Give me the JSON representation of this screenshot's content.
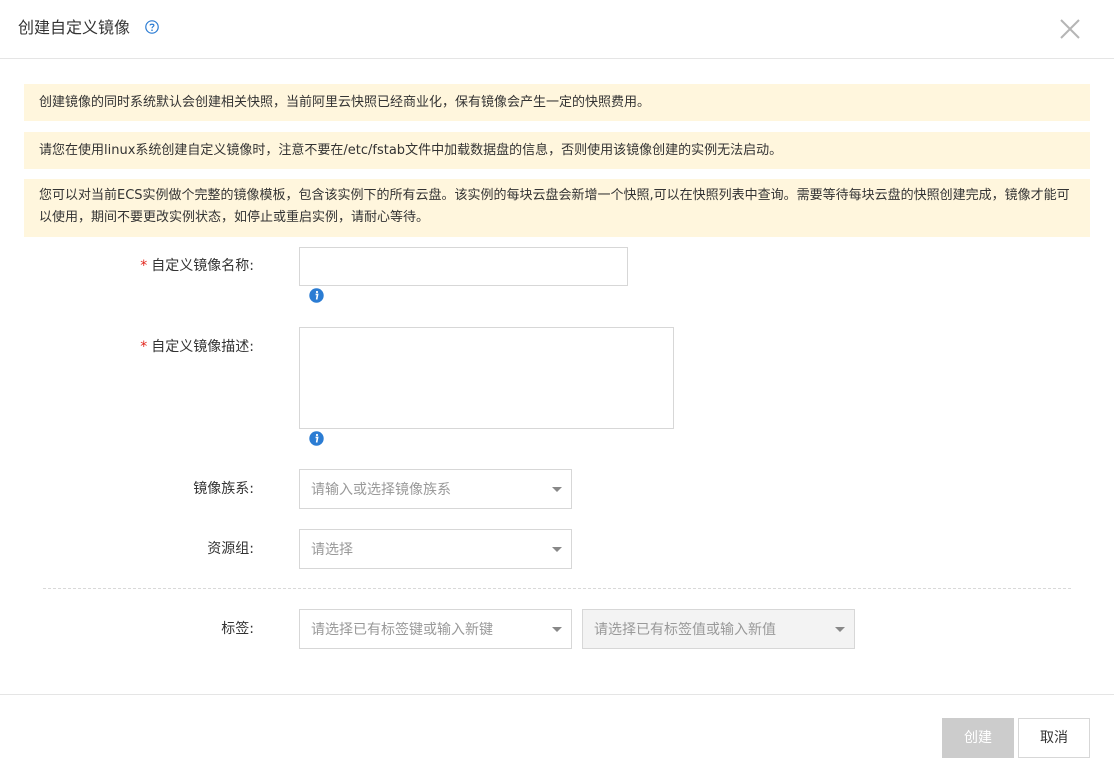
{
  "dialog": {
    "title": "创建自定义镜像",
    "help_icon": "question-circle-icon",
    "close_icon": "close-icon"
  },
  "notices": [
    "创建镜像的同时系统默认会创建相关快照，当前阿里云快照已经商业化，保有镜像会产生一定的快照费用。",
    "请您在使用linux系统创建自定义镜像时，注意不要在/etc/fstab文件中加载数据盘的信息，否则使用该镜像创建的实例无法启动。",
    "您可以对当前ECS实例做个完整的镜像模板，包含该实例下的所有云盘。该实例的每块云盘会新增一个快照,可以在快照列表中查询。需要等待每块云盘的快照创建完成，镜像才能可以使用，期间不要更改实例状态，如停止或重启实例，请耐心等待。"
  ],
  "form": {
    "required_mark": "*",
    "name_label": "自定义镜像名称:",
    "name_value": "",
    "desc_label": "自定义镜像描述:",
    "desc_value": "",
    "family_label": "镜像族系:",
    "family_placeholder": "请输入或选择镜像族系",
    "resource_group_label": "资源组:",
    "resource_group_placeholder": "请选择",
    "tag_label": "标签:",
    "tag_key_placeholder": "请选择已有标签键或输入新键",
    "tag_value_placeholder": "请选择已有标签值或输入新值",
    "info_icon": "info-icon"
  },
  "footer": {
    "create_label": "创建",
    "cancel_label": "取消"
  },
  "colors": {
    "notice_bg": "#fff6dd",
    "required": "#e2231a",
    "info_blue": "#2b7cd3",
    "create_disabled": "#cccccc"
  }
}
